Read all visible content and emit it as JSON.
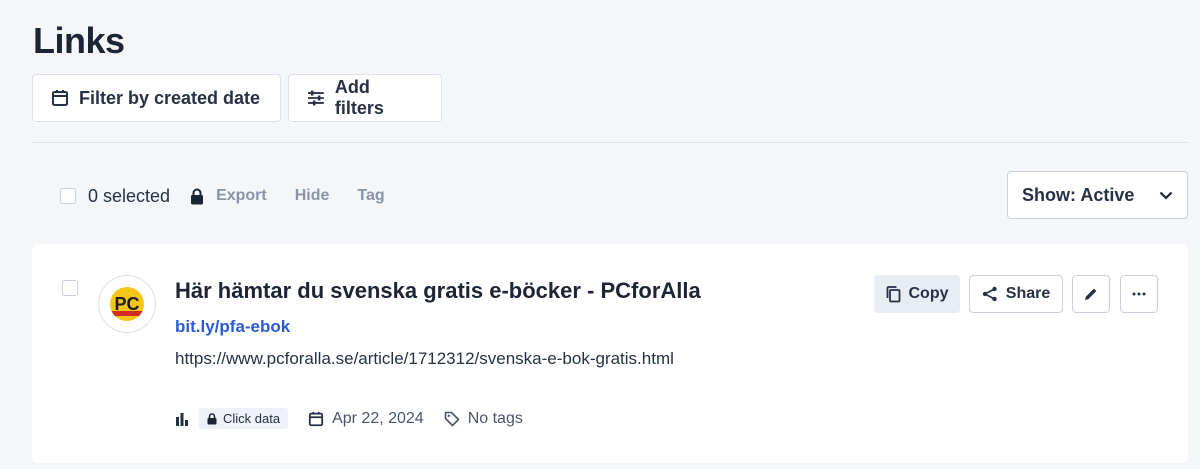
{
  "page": {
    "title": "Links"
  },
  "toolbar": {
    "filter_date_label": "Filter by created date",
    "add_filters_label": "Add filters"
  },
  "selection": {
    "count_label": "0 selected",
    "export_label": "Export",
    "hide_label": "Hide",
    "tag_label": "Tag"
  },
  "show_select": {
    "value": "Show: Active"
  },
  "link": {
    "title": "Här hämtar du svenska gratis e-böcker - PCforAlla",
    "short_url": "bit.ly/pfa-ebok",
    "long_url": "https://www.pcforalla.se/article/1712312/svenska-e-bok-gratis.html",
    "favicon_text": "PC",
    "click_data_label": "Click data",
    "date": "Apr 22, 2024",
    "tags": "No tags",
    "copy_label": "Copy",
    "share_label": "Share"
  },
  "colors": {
    "background": "#f4f6fa",
    "link_blue": "#2a5bd7",
    "muted_action": "#8a94a8"
  }
}
